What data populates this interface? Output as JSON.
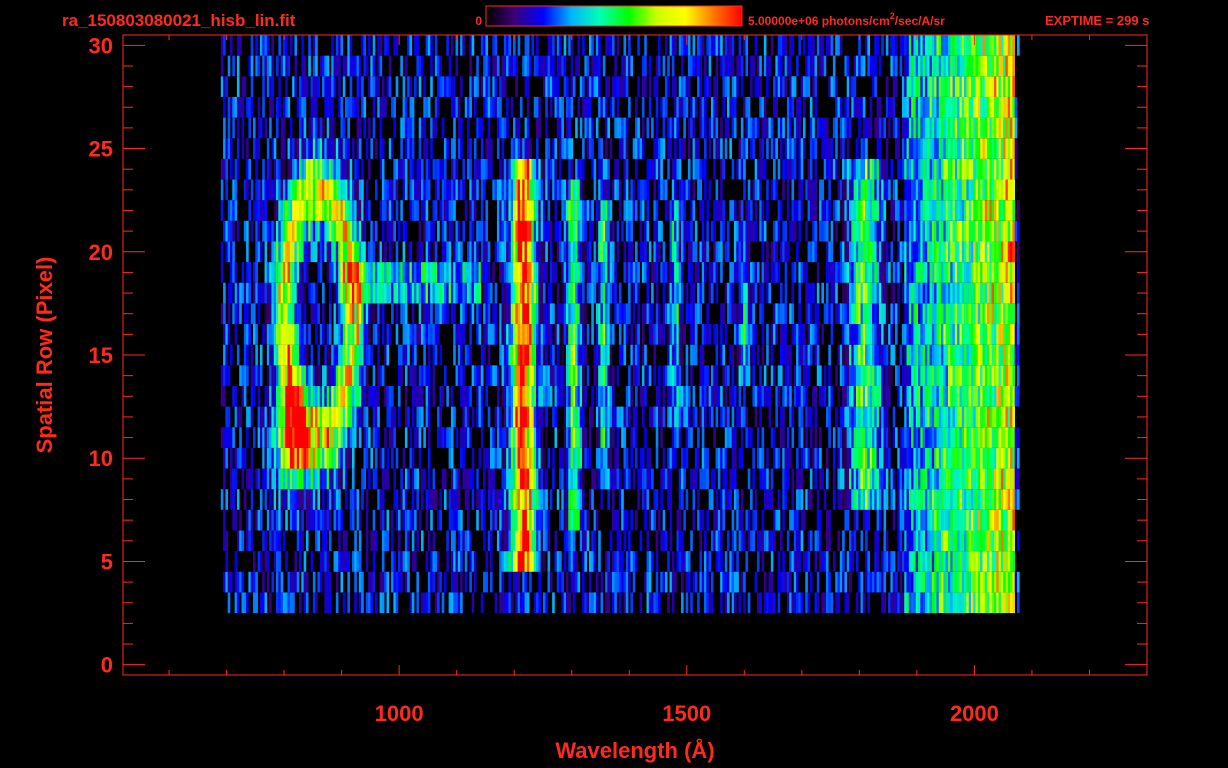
{
  "colors": {
    "background": "#000000",
    "foreground": "#ff2a1f"
  },
  "header": {
    "filename": "ra_150803080021_hisb_lin.fit",
    "colorbar_min_label": "0",
    "colorbar_max_label": "5.00000e+06 photons/cm",
    "colorbar_max_label_sup": "2",
    "colorbar_max_label_tail": "/sec/A/sr",
    "exposure": "EXPTIME = 299 s"
  },
  "colorbar": {
    "min": 0,
    "max": 5000000,
    "stops": [
      "#000000",
      "#3c0078",
      "#0000ff",
      "#00b4ff",
      "#00ffb4",
      "#00ff00",
      "#c8ff00",
      "#ffff00",
      "#ff7800",
      "#ff0000"
    ]
  },
  "chart_data": {
    "type": "heatmap",
    "title": "ra_150803080021_hisb_lin.fit",
    "xlabel": "Wavelength (Å)",
    "ylabel": "Spatial Row (Pixel)",
    "xlim": [
      520,
      2300
    ],
    "ylim": [
      -0.5,
      30.5
    ],
    "x_ticks": [
      1000,
      1500,
      2000
    ],
    "y_ticks": [
      0,
      5,
      10,
      15,
      20,
      25,
      30
    ],
    "x_minor_step": 100,
    "y_minor_step": 1,
    "grid": false,
    "colorbar_units": "photons/cm^2/sec/A/sr",
    "detector_wavelength_range": [
      690,
      2075
    ],
    "detector_row_range": [
      3,
      30
    ],
    "features": [
      {
        "name": "ring",
        "center_wavelength": 860,
        "center_row": 17,
        "wavelength_half_width": 60,
        "row_half_width": 6,
        "peak_fraction": 0.62
      },
      {
        "name": "ring-bright-edge",
        "center_wavelength": 815,
        "center_row": 11,
        "wavelength_half_width": 20,
        "row_half_width": 1.5,
        "peak_fraction": 0.85
      },
      {
        "name": "line",
        "center_wavelength": 1216,
        "row_range": [
          5,
          24
        ],
        "wavelength_half_width": 14,
        "peak_fraction": 0.88
      },
      {
        "name": "line",
        "center_wavelength": 1304,
        "row_range": [
          7,
          23
        ],
        "wavelength_half_width": 8,
        "peak_fraction": 0.42
      },
      {
        "name": "line",
        "center_wavelength": 1356,
        "row_range": [
          9,
          22
        ],
        "wavelength_half_width": 6,
        "peak_fraction": 0.32
      },
      {
        "name": "line",
        "center_wavelength": 1480,
        "row_range": [
          12,
          22
        ],
        "wavelength_half_width": 6,
        "peak_fraction": 0.28
      },
      {
        "name": "line",
        "center_wavelength": 1600,
        "row_range": [
          14,
          21
        ],
        "wavelength_half_width": 6,
        "peak_fraction": 0.28
      },
      {
        "name": "line",
        "center_wavelength": 1810,
        "row_range": [
          8,
          24
        ],
        "wavelength_half_width": 18,
        "peak_fraction": 0.38
      },
      {
        "name": "band",
        "start_wavelength": 1880,
        "end_wavelength": 2070,
        "row_range": [
          3,
          30
        ],
        "peak_fraction": 0.6
      },
      {
        "name": "bridge",
        "row": 18.5,
        "wavelength_range": [
          900,
          1140
        ],
        "peak_fraction": 0.35
      }
    ]
  }
}
